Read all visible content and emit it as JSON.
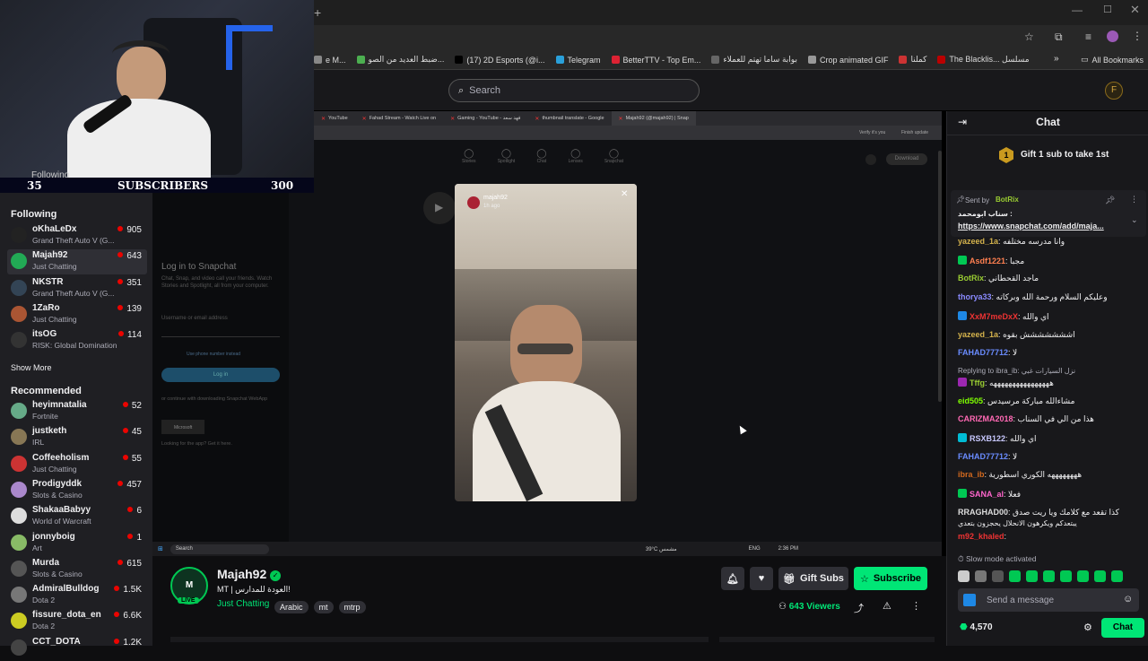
{
  "bookmarks": [
    {
      "label": "e M...",
      "color": "#888"
    },
    {
      "label": "ضبط العديد من الصو...",
      "color": "#4caf50"
    },
    {
      "label": "(17) 2D Esports (@i...",
      "color": "#000"
    },
    {
      "label": "Telegram",
      "color": "#2aa0da"
    },
    {
      "label": "BetterTTV - Top Em...",
      "color": "#d23"
    },
    {
      "label": "بوابة ساما تهتم للعملاء",
      "color": "#666"
    },
    {
      "label": "Crop animated GIF",
      "color": "#999"
    },
    {
      "label": "كملنا",
      "color": "#c33"
    },
    {
      "label": "The Blacklis... مسلسل",
      "color": "#b00"
    }
  ],
  "all_bookmarks": "All Bookmarks",
  "search_placeholder": "Search",
  "webcam": {
    "following_label": "Following",
    "following_count": "35",
    "subscribers_label": "SUBSCRIBERS",
    "subscribers_count": "300"
  },
  "sidebar": {
    "following_title": "Following",
    "following": [
      {
        "name": "oKhaLeDx",
        "game": "Grand Theft Auto V (G...",
        "viewers": "905",
        "color": "#222"
      },
      {
        "name": "Majah92",
        "game": "Just Chatting",
        "viewers": "643",
        "color": "#2a5",
        "selected": true
      },
      {
        "name": "NKSTR",
        "game": "Grand Theft Auto V (G...",
        "viewers": "351",
        "color": "#345"
      },
      {
        "name": "1ZaRo",
        "game": "Just Chatting",
        "viewers": "139",
        "color": "#a53"
      },
      {
        "name": "itsOG",
        "game": "RISK: Global Domination",
        "viewers": "114",
        "color": "#333"
      }
    ],
    "show_more": "Show More",
    "recommended_title": "Recommended",
    "recommended": [
      {
        "name": "heyimnatalia",
        "game": "Fortnite",
        "viewers": "52",
        "color": "#6a8"
      },
      {
        "name": "justketh",
        "game": "IRL",
        "viewers": "45",
        "color": "#875"
      },
      {
        "name": "Coffeeholism",
        "game": "Just Chatting",
        "viewers": "55",
        "color": "#c33"
      },
      {
        "name": "Prodigyddk",
        "game": "Slots & Casino",
        "viewers": "457",
        "color": "#a8c"
      },
      {
        "name": "ShakaaBabyy",
        "game": "World of Warcraft",
        "viewers": "6",
        "color": "#ddd"
      },
      {
        "name": "jonnyboig",
        "game": "Art",
        "viewers": "1",
        "color": "#8b6"
      },
      {
        "name": "Murda",
        "game": "Slots & Casino",
        "viewers": "615",
        "color": "#555"
      },
      {
        "name": "AdmiralBulldog",
        "game": "Dota 2",
        "viewers": "1.5K",
        "color": "#777"
      },
      {
        "name": "fissure_dota_en",
        "game": "Dota 2",
        "viewers": "6.6K",
        "color": "#cc2"
      },
      {
        "name": "CCT_DOTA",
        "game": "",
        "viewers": "1.2K",
        "color": "#444"
      }
    ]
  },
  "inner_tabs": [
    "YouTube",
    "Fahad Stream - Watch Live on",
    "Gaming - YouTube - فهد سعد",
    "thumbnail translate - Google",
    "Majah92 (@majah92) | Snap"
  ],
  "snap": {
    "nav": [
      "Stories",
      "Spotlight",
      "Chat",
      "Lenses",
      "Snapchat"
    ],
    "download": "Download",
    "login_title": "Log in to Snapchat",
    "login_sub": "Chat, Snap, and video call your friends. Watch Stories and Spotlight, all from your computer.",
    "username_label": "Username or email address",
    "phone_link": "Use phone number instead",
    "login_btn": "Log in",
    "or_text": "or continue with downloading Snapchat WebApp",
    "ms_label": "Microsoft",
    "looking_text": "Looking for the app? Get it here.",
    "video_user": "majah92",
    "video_time": "1h ago"
  },
  "taskbar": {
    "search": "Search",
    "weather": "39°C مشمس",
    "lang": "ENG",
    "time": "2:36 PM"
  },
  "stream": {
    "channel": "Majah92",
    "title": "MT | العودة للمدارس!",
    "category": "Just Chatting",
    "tags": [
      "Arabic",
      "mt",
      "mtrp"
    ],
    "live": "LIVE",
    "gift_subs": "Gift Subs",
    "subscribe": "Subscribe",
    "viewers": "643",
    "viewers_label": "Viewers"
  },
  "chat": {
    "title": "Chat",
    "gift_banner": "Gift 1 sub to take 1st",
    "gift_count": "1",
    "pinned_by_label": "Sent by",
    "pinned_by": "BotRix",
    "pinned_title": "سناب ابومحمد :",
    "pinned_link": "https://www.snapchat.com/add/maja...",
    "messages": [
      {
        "user": "yazeed_1a",
        "text": "وانا مدرسه مختلفه",
        "color": "#d4b24c"
      },
      {
        "user": "Asdf1221",
        "text": "مجبا",
        "color": "#ff7f50"
      },
      {
        "user": "BotRix",
        "text": "ماجد القحطاني",
        "color": "#9acd32"
      },
      {
        "user": "thorya33",
        "text": "وعليكم السلام ورحمة الله وبركاته",
        "color": "#8a8aff"
      },
      {
        "user": "XxM7meDxX",
        "text": "اي والله",
        "color": "#e33"
      },
      {
        "user": "yazeed_1a",
        "text": "اششششششش بقوه",
        "color": "#d4b24c"
      },
      {
        "user": "FAHAD77712",
        "text": "لا",
        "color": "#6a8cff"
      },
      {
        "user": "Tffg",
        "text": "ههههههههههههههههه",
        "color": "#9acd32"
      },
      {
        "user": "eid505",
        "text": "مشاءالله مباركة مرسيدس",
        "color": "#7fff00"
      },
      {
        "user": "CARIZMA2018",
        "text": "هذا من الي في السناب",
        "color": "#ff69b4"
      },
      {
        "user": "RSXB122",
        "text": "اي والله",
        "color": "#c9c9ff"
      },
      {
        "user": "FAHAD77712",
        "text": "لا",
        "color": "#6a8cff"
      },
      {
        "user": "ibra_ib",
        "text": "ههههههههه الكوري اسطورية",
        "color": "#d2691e"
      },
      {
        "user": "SANA_al",
        "text": "فعلا",
        "color": "#ff66cc"
      },
      {
        "user": "RRAGHAD00",
        "text": "كذا تقعد مع كلامك ويا ريت صدق",
        "color": "#ddd"
      },
      {
        "user": "m92_khaled",
        "text": "",
        "color": "#e33"
      }
    ],
    "reply_prefix": "Replying to ibra_ib:",
    "reply_text": "نزل السيارات غبي",
    "raghad_line2": "يبتعدكم ويكرهون الانحلال يحجزون بتعدي",
    "slow_mode": "Slow mode activated",
    "send_placeholder": "Send a message",
    "points": "4,570",
    "chat_btn": "Chat"
  }
}
